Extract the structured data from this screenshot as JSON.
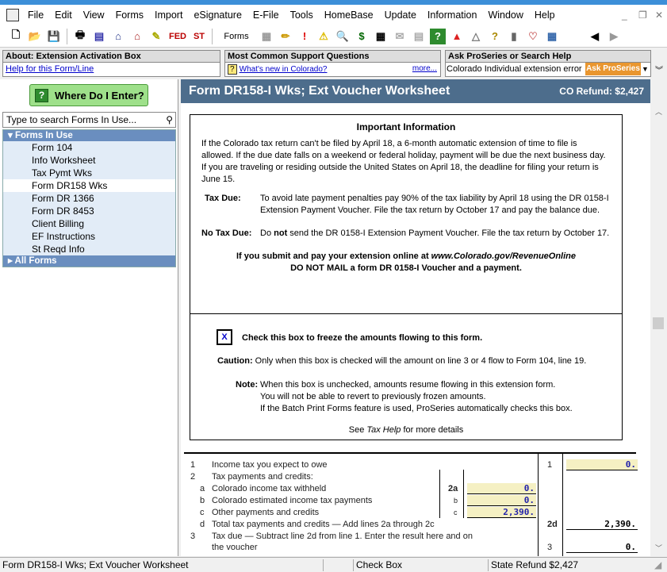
{
  "menu": [
    "File",
    "Edit",
    "View",
    "Forms",
    "Import",
    "eSignature",
    "E-File",
    "Tools",
    "HomeBase",
    "Update",
    "Information",
    "Window",
    "Help"
  ],
  "toolbar": {
    "fed": "FED",
    "st": "ST",
    "forms": "Forms"
  },
  "panels": {
    "about": {
      "title": "About: Extension Activation Box",
      "link": "Help for this Form/Line"
    },
    "support": {
      "title": "Most Common Support Questions",
      "link": "What's new in Colorado?",
      "more": "more..."
    },
    "ask": {
      "title": "Ask ProSeries or Search Help",
      "query": "Colorado Individual extension error",
      "button": "Ask ProSeries"
    }
  },
  "sidebar": {
    "where_button": "Where Do I Enter?",
    "search_placeholder": "Type to search Forms In Use...",
    "group_in_use": "Forms In Use",
    "items": [
      "Form 104",
      "Info Worksheet",
      "Tax Pymt Wks",
      "Form DR158 Wks",
      "Form DR 1366",
      "Form DR 8453",
      "Client Billing",
      "EF Instructions",
      "St Reqd Info"
    ],
    "selected": "Form DR158 Wks",
    "group_all": "All Forms"
  },
  "form": {
    "title": "Form DR158-I  Wks; Ext Voucher Worksheet",
    "refund": "CO Refund: $2,427",
    "info_heading": "Important Information",
    "para1": "If the Colorado tax return can't be filed by April 18, a 6-month automatic extension of time to file is allowed.  If the due date falls on a weekend or federal holiday, payment will be due the next business day.  If you are traveling or residing outside the United States on  April 18, the deadline for filing your return is June 15.",
    "taxdue_label": "Tax Due:",
    "taxdue_text": "To avoid late payment penalties pay 90% of the tax liability by April 18 using the DR 0158-I Extension Payment Voucher. File the tax return by October 17 and pay the balance due.",
    "notax_label": "No Tax Due:",
    "notax_pre": "Do ",
    "notax_bold": "not",
    "notax_post": " send the DR 0158-I Extension Payment Voucher. File the tax return by October 17.",
    "online_pre": "If you  submit and pay your extension online at ",
    "online_url": "www.Colorado.gov/RevenueOnline",
    "online_line2": "DO NOT MAIL a form DR 0158-I Voucher and a payment.",
    "checkbox_value": "X",
    "checkbox_label": "Check this box to freeze the amounts flowing to this form.",
    "caution_label": "Caution:",
    "caution_text": "Only when this box is checked will the amount on line 3 or 4 flow to  Form 104, line 19.",
    "note_label": "Note:",
    "note_lines": [
      "When this box is unchecked, amounts resume flowing in this extension form.",
      "You will not be able to revert to previously frozen amounts.",
      "If the Batch Print Forms feature is used, ProSeries automatically checks this box."
    ],
    "see_pre": "See ",
    "see_em": "Tax Help",
    "see_post": " for more details",
    "lines": {
      "l1": {
        "num": "1",
        "text": "Income tax you expect to owe",
        "box": "1",
        "value": "0."
      },
      "l2": {
        "num": "2",
        "text": "Tax payments and credits:"
      },
      "l2a": {
        "num": "a",
        "text": "Colorado income tax withheld",
        "box": "2a",
        "value": "0."
      },
      "l2b": {
        "num": "b",
        "text": "Colorado estimated income tax payments",
        "box": "b",
        "value": "0."
      },
      "l2c": {
        "num": "c",
        "text": "Other payments and credits",
        "box": "c",
        "value": "2,390."
      },
      "l2d": {
        "num": "d",
        "text": "Total tax payments and credits — Add lines 2a through 2c",
        "box": "2d",
        "value": "2,390."
      },
      "l3": {
        "num": "3",
        "text": "Tax due — Subtract line 2d from line 1. Enter the result here and on",
        "text2": "the voucher",
        "box": "3",
        "value": "0."
      }
    }
  },
  "status": {
    "form": "Form DR158-I  Wks; Ext Voucher Worksheet",
    "field": "Check Box",
    "refund": "State Refund $2,427"
  },
  "colors": {
    "header": "#4d6d8c",
    "sidebar_group": "#6a8ebf",
    "input_fill": "#f5f0c3",
    "where_button": "#9ee08a"
  }
}
